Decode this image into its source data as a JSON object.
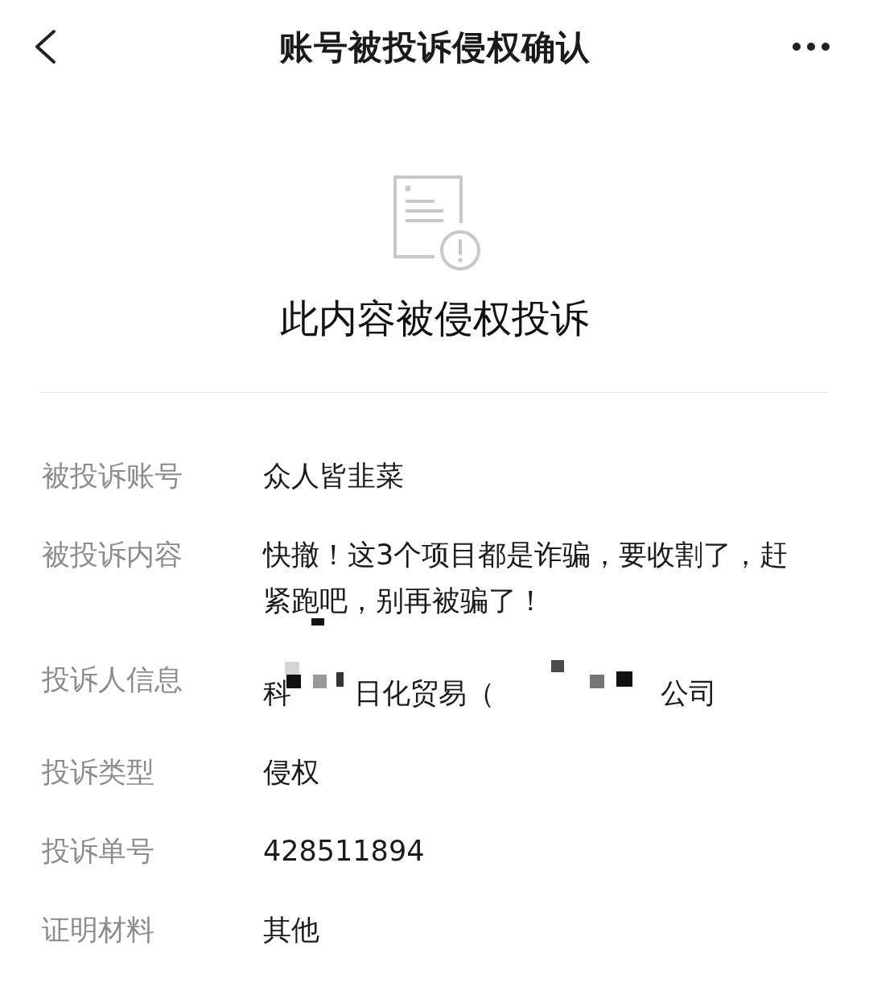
{
  "header": {
    "title": "账号被投诉侵权确认"
  },
  "notice": {
    "heading": "此内容被侵权投诉"
  },
  "details": [
    {
      "label": "被投诉账号",
      "value": "众人皆韭菜"
    },
    {
      "label": "被投诉内容",
      "value": "快撤！这3个项目都是诈骗，要收割了，赶紧跑吧，别再被骗了！",
      "redaction_mark": true
    },
    {
      "label": "投诉人信息",
      "parts": [
        {
          "kind": "text",
          "text": "科"
        },
        {
          "kind": "redacted"
        },
        {
          "kind": "text",
          "text": "日化贸易（"
        },
        {
          "kind": "redacted"
        },
        {
          "kind": "text",
          "text": "公司"
        }
      ]
    },
    {
      "label": "投诉类型",
      "value": "侵权"
    },
    {
      "label": "投诉单号",
      "value": "428511894"
    },
    {
      "label": "证明材料",
      "value": "其他"
    }
  ]
}
